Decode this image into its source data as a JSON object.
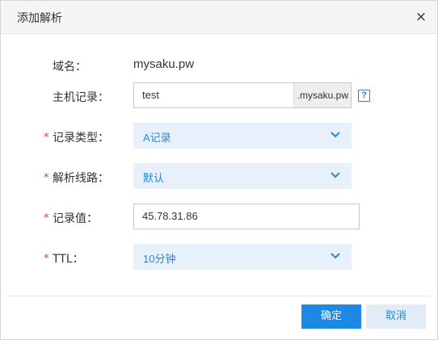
{
  "dialog": {
    "title": "添加解析",
    "close_symbol": "×"
  },
  "form": {
    "domain": {
      "label": "域名：",
      "value": "mysaku.pw"
    },
    "host": {
      "label": "主机记录：",
      "value": "test",
      "suffix": ".mysaku.pw",
      "help_symbol": "?"
    },
    "record_type": {
      "required": "*",
      "label": "记录类型：",
      "value": "A记录"
    },
    "line": {
      "required": "*",
      "label": "解析线路：",
      "value": "默认"
    },
    "record_value": {
      "required": "*",
      "label": "记录值：",
      "value": "45.78.31.86"
    },
    "ttl": {
      "required": "*",
      "label": "TTL：",
      "value": "10分钟"
    }
  },
  "footer": {
    "ok_label": "确定",
    "cancel_label": "取消"
  },
  "colors": {
    "accent": "#1e88e5",
    "select_bg": "#e8f1fb",
    "required": "#e53935"
  }
}
